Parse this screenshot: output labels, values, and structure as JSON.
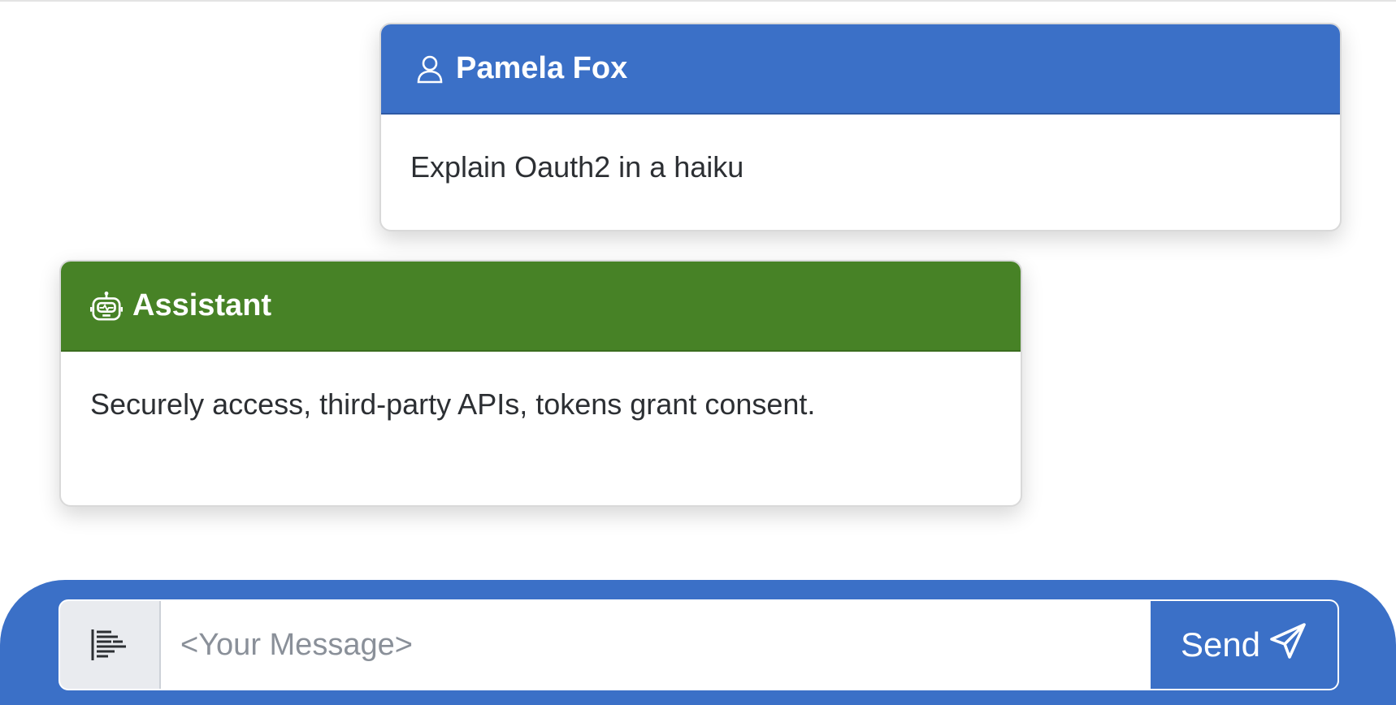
{
  "messages": [
    {
      "role": "user",
      "author": "Pamela Fox",
      "icon": "person-icon",
      "text": "Explain Oauth2 in a haiku",
      "header_color": "#3b70c7"
    },
    {
      "role": "assistant",
      "author": "Assistant",
      "icon": "robot-icon",
      "text": "Securely access, third-party APIs, tokens grant consent.",
      "header_color": "#478226"
    }
  ],
  "composer": {
    "prefix_icon": "text-lines-icon",
    "placeholder": "<Your Message>",
    "value": "",
    "send_label": "Send",
    "send_icon": "paper-plane-icon",
    "bar_color": "#3b70c7"
  }
}
